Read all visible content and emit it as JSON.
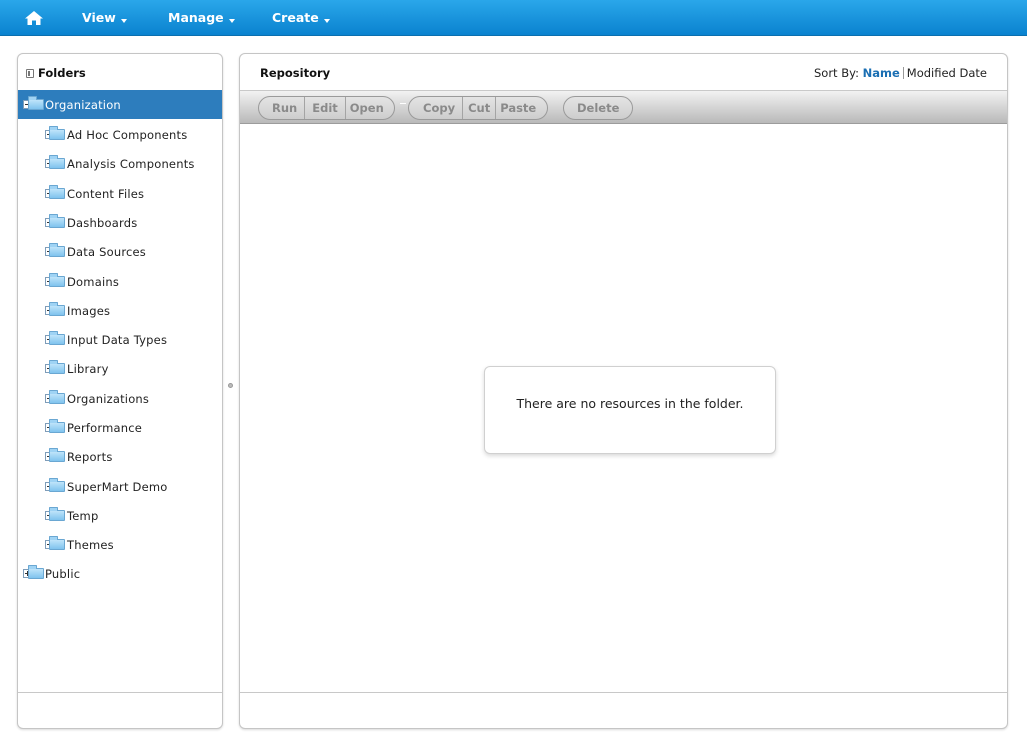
{
  "nav": {
    "home_icon": "home-icon",
    "items": [
      {
        "label": "View"
      },
      {
        "label": "Manage"
      },
      {
        "label": "Create"
      }
    ],
    "bar_color": "#1193dd"
  },
  "folders_panel": {
    "title": "Folders",
    "tree": {
      "root": {
        "label": "Organization",
        "expanded": true,
        "selected": true
      },
      "children": [
        {
          "label": "Ad Hoc Components"
        },
        {
          "label": "Analysis Components"
        },
        {
          "label": "Content Files"
        },
        {
          "label": "Dashboards"
        },
        {
          "label": "Data Sources"
        },
        {
          "label": "Domains"
        },
        {
          "label": "Images"
        },
        {
          "label": "Input Data Types"
        },
        {
          "label": "Library"
        },
        {
          "label": "Organizations"
        },
        {
          "label": "Performance"
        },
        {
          "label": "Reports"
        },
        {
          "label": "SuperMart Demo"
        },
        {
          "label": "Temp"
        },
        {
          "label": "Themes"
        }
      ],
      "sibling": {
        "label": "Public",
        "expanded": false
      }
    },
    "selected_color": "#2d7dbd"
  },
  "repository_panel": {
    "title": "Repository",
    "sort": {
      "label": "Sort By:",
      "name_option": "Name",
      "date_option": "Modified Date",
      "active": "Name"
    },
    "toolbar": {
      "group1": [
        "Run",
        "Edit",
        "Open"
      ],
      "group2": [
        "Copy",
        "Cut",
        "Paste"
      ],
      "group3": [
        "Delete"
      ],
      "enabled": false
    },
    "empty_message": "There are no resources in the folder."
  }
}
